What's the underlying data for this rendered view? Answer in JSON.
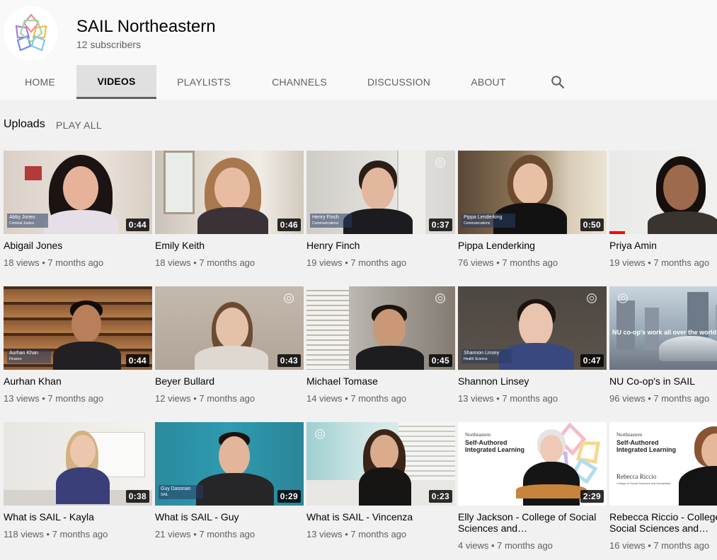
{
  "channel": {
    "name": "SAIL Northeastern",
    "subscribers": "12 subscribers"
  },
  "tabs": [
    "HOME",
    "VIDEOS",
    "PLAYLISTS",
    "CHANNELS",
    "DISCUSSION",
    "ABOUT"
  ],
  "active_tab": "VIDEOS",
  "uploads": {
    "title": "Uploads",
    "play_all": "PLAY ALL"
  },
  "videos": [
    {
      "title": "Abigail Jones",
      "meta": "18 views • 7 months ago",
      "duration": "0:44",
      "lower_third": "Abby Jones",
      "lower_third_sub": "Criminal Justice"
    },
    {
      "title": "Emily Keith",
      "meta": "18 views • 7 months ago",
      "duration": "0:46"
    },
    {
      "title": "Henry Finch",
      "meta": "19 views • 7 months ago",
      "duration": "0:37",
      "lower_third": "Henry Finch",
      "lower_third_sub": "Communications"
    },
    {
      "title": "Pippa Lenderking",
      "meta": "76 views • 7 months ago",
      "duration": "0:50",
      "lower_third": "Pippa Lenderking",
      "lower_third_sub": "Communications"
    },
    {
      "title": "Priya Amin",
      "meta": "19 views • 7 months ago",
      "duration": ""
    },
    {
      "title": "Aurhan Khan",
      "meta": "13 views • 7 months ago",
      "duration": "0:44",
      "lower_third": "Aurhan Khan",
      "lower_third_sub": "Finance"
    },
    {
      "title": "Beyer Bullard",
      "meta": "12 views • 7 months ago",
      "duration": "0:43"
    },
    {
      "title": "Michael Tomase",
      "meta": "14 views • 7 months ago",
      "duration": "0:45"
    },
    {
      "title": "Shannon Linsey",
      "meta": "13 views • 7 months ago",
      "duration": "0:47",
      "lower_third": "Shannon Linsey",
      "lower_third_sub": "Health Science"
    },
    {
      "title": "NU Co-op's in SAIL",
      "meta": "96 views • 7 months ago",
      "duration": "",
      "overlay_text": "NU co-op's work all over the world"
    },
    {
      "title": "What is SAIL - Kayla",
      "meta": "118 views • 7 months ago",
      "duration": "0:38"
    },
    {
      "title": "What is SAIL - Guy",
      "meta": "21 views • 7 months ago",
      "duration": "0:29",
      "lower_third": "Guy Dassnan",
      "lower_third_sub": "SAIL"
    },
    {
      "title": "What is SAIL - Vincenza",
      "meta": "13 views • 7 months ago",
      "duration": "0:23"
    },
    {
      "title": "Elly Jackson - College of Social Sciences and…",
      "meta": "4 views • 7 months ago",
      "duration": "2:29",
      "slide_brand": "Northeastern",
      "slide_title": "Self-Authored Integrated Learning"
    },
    {
      "title": "Rebecca Riccio - College of Social Sciences and…",
      "meta": "16 views • 7 months ago",
      "duration": "",
      "slide_brand": "Northeastern",
      "slide_title": "Self-Authored Integrated Learning",
      "slide_name": "Rebecca Riccio",
      "slide_sub": "College of Social Sciences and Humanities"
    }
  ]
}
